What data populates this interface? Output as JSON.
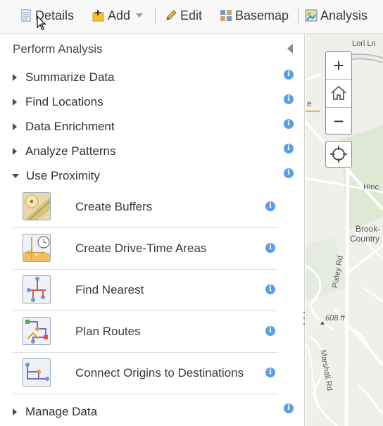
{
  "toolbar": {
    "details_label": "Details",
    "add_label": "Add",
    "edit_label": "Edit",
    "basemap_label": "Basemap",
    "analysis_label": "Analysis"
  },
  "panel": {
    "title": "Perform Analysis",
    "categories": [
      {
        "label": "Summarize Data",
        "expanded": false
      },
      {
        "label": "Find Locations",
        "expanded": false
      },
      {
        "label": "Data Enrichment",
        "expanded": false
      },
      {
        "label": "Analyze Patterns",
        "expanded": false
      },
      {
        "label": "Use Proximity",
        "expanded": true
      },
      {
        "label": "Manage Data",
        "expanded": false
      }
    ],
    "tools": [
      {
        "label": "Create Buffers"
      },
      {
        "label": "Create Drive-Time Areas"
      },
      {
        "label": "Find Nearest"
      },
      {
        "label": "Plan Routes"
      },
      {
        "label": "Connect Origins to Destinations"
      }
    ],
    "info_glyph": "i"
  },
  "map": {
    "labels": {
      "street_top": "Lori Ln",
      "street_mid": "Hinc",
      "place": "Brook-",
      "place2": "Country",
      "pixley": "Pixley Rd",
      "elevation": "608 ft",
      "marshall": "Marshall Rd",
      "e_fragment": "e"
    },
    "zoom_in_glyph": "+",
    "zoom_out_glyph": "−"
  },
  "colors": {
    "accent_info": "#5a9ee8",
    "map_bg": "#f1efeb"
  }
}
